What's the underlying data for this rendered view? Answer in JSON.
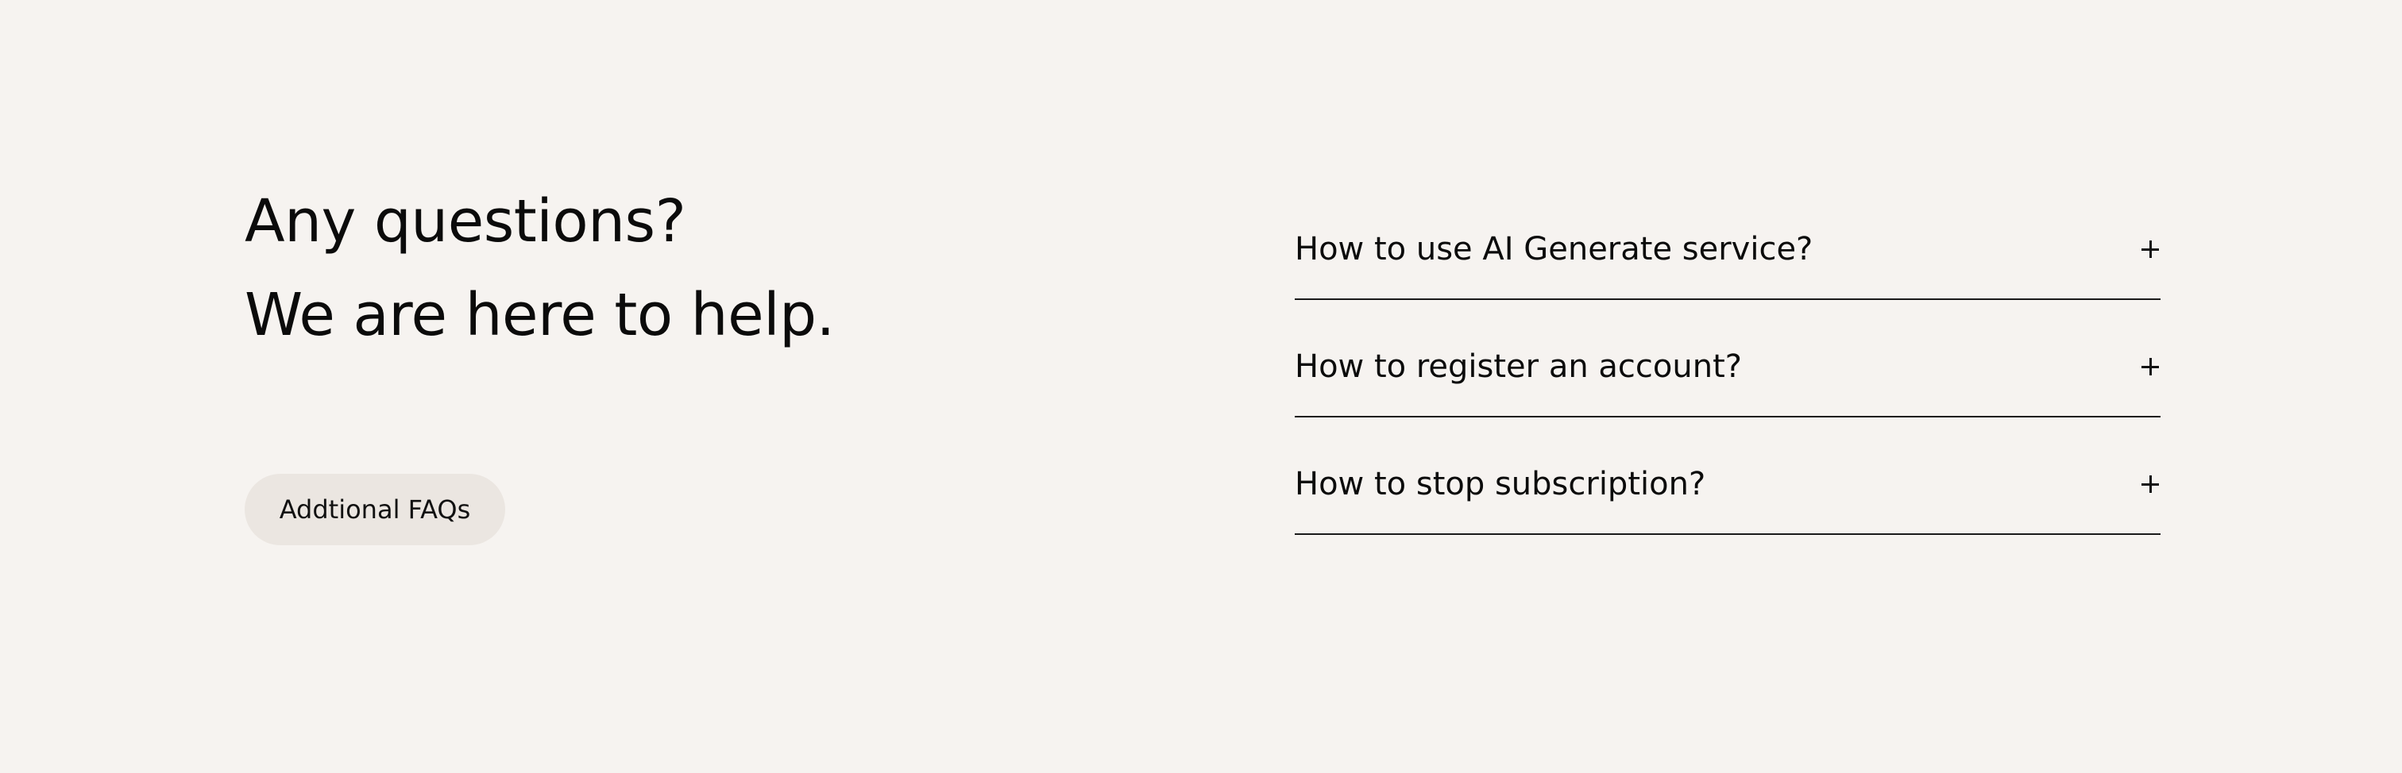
{
  "hero": {
    "line1": "Any questions?",
    "line2": "We are here to help."
  },
  "cta": {
    "label": "Addtional FAQs"
  },
  "faq": {
    "items": [
      {
        "question": "How to use AI Generate service?",
        "icon": "plus-icon"
      },
      {
        "question": "How to register an account?",
        "icon": "plus-icon"
      },
      {
        "question": "How to stop subscription?",
        "icon": "plus-icon"
      }
    ]
  },
  "colors": {
    "background": "#f6f3f0",
    "button_bg": "#ebe6e1",
    "text": "#0b0b0b"
  }
}
